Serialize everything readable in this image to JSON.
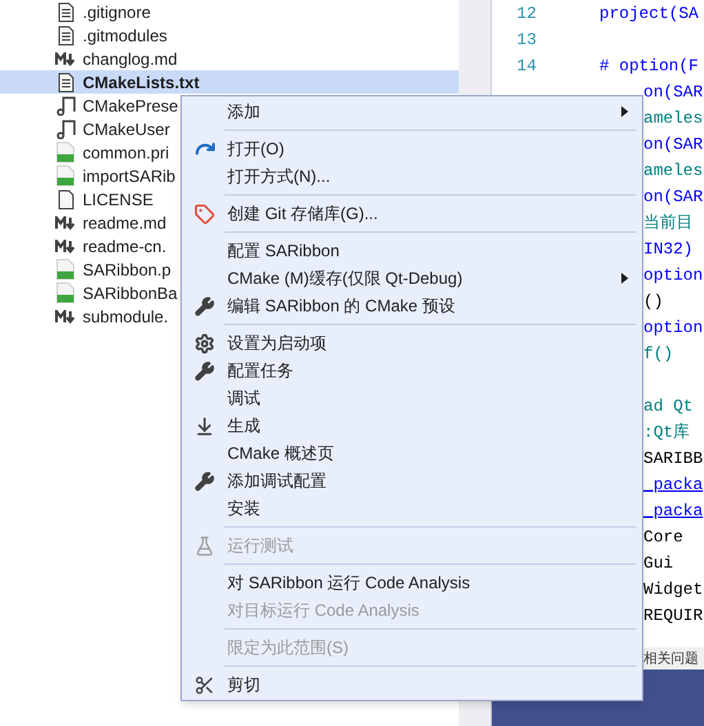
{
  "solution_explorer": {
    "items": [
      {
        "name": ".gitignore",
        "kind": "text",
        "selected": false
      },
      {
        "name": ".gitmodules",
        "kind": "text",
        "selected": false
      },
      {
        "name": "changlog.md",
        "kind": "markdown",
        "selected": false
      },
      {
        "name": "CMakeLists.txt",
        "kind": "text",
        "selected": true
      },
      {
        "name": "CMakePrese",
        "kind": "json",
        "selected": false
      },
      {
        "name": "CMakeUser",
        "kind": "json",
        "selected": false
      },
      {
        "name": "common.pri",
        "kind": "pro",
        "selected": false
      },
      {
        "name": "importSARib",
        "kind": "pro",
        "selected": false
      },
      {
        "name": "LICENSE",
        "kind": "blank",
        "selected": false
      },
      {
        "name": "readme.md",
        "kind": "markdown",
        "selected": false
      },
      {
        "name": "readme-cn.",
        "kind": "markdown",
        "selected": false
      },
      {
        "name": "SARibbon.p",
        "kind": "pro",
        "selected": false
      },
      {
        "name": "SARibbonBa",
        "kind": "pro",
        "selected": false
      },
      {
        "name": "submodule.",
        "kind": "markdown",
        "selected": false
      }
    ]
  },
  "editor": {
    "blocks": [
      {
        "lines": [
          {
            "number": "12",
            "segments": [
              {
                "text": "project(SA",
                "kind": "keyword"
              }
            ]
          },
          {
            "number": "13"
          },
          {
            "number": "14",
            "segments": [
              {
                "text": "# option(F",
                "kind": "keyword"
              }
            ]
          },
          {
            "segments": [
              {
                "text": "on(SAR",
                "kind": "keyword"
              }
            ]
          },
          {
            "segments": [
              {
                "text": "ameles",
                "kind": "comment"
              }
            ]
          },
          {
            "segments": [
              {
                "text": "on(SAR",
                "kind": "keyword"
              }
            ]
          },
          {
            "segments": [
              {
                "text": "ameles",
                "kind": "comment"
              }
            ]
          },
          {
            "segments": [
              {
                "text": "on(SAR",
                "kind": "keyword"
              }
            ]
          },
          {
            "segments": [
              {
                "text": "当前目",
                "kind": "comment"
              }
            ]
          },
          {
            "segments": [
              {
                "text": "IN32)",
                "kind": "keyword"
              }
            ]
          },
          {
            "segments": [
              {
                "text": "option",
                "kind": "keyword"
              }
            ]
          },
          {
            "segments": [
              {
                "text": "()",
                "kind": "plain"
              }
            ]
          },
          {
            "segments": [
              {
                "text": "option",
                "kind": "keyword"
              }
            ]
          },
          {
            "segments": [
              {
                "text": "f()",
                "kind": "comment"
              }
            ]
          }
        ]
      },
      {
        "lines": [
          {
            "segments": [
              {
                "text": "ad Qt",
                "kind": "comment"
              }
            ]
          },
          {
            "segments": [
              {
                "text": ":Qt库",
                "kind": "comment"
              }
            ]
          },
          {
            "segments": [
              {
                "text": "SARIBB",
                "kind": "plain"
              }
            ]
          },
          {
            "segments": [
              {
                "text": "_packa",
                "kind": "link"
              }
            ]
          },
          {
            "segments": [
              {
                "text": "_packa",
                "kind": "link"
              }
            ]
          },
          {
            "segments": [
              {
                "text": "Core",
                "kind": "plain"
              }
            ]
          },
          {
            "segments": [
              {
                "text": "Gui",
                "kind": "plain"
              }
            ]
          },
          {
            "segments": [
              {
                "text": "Widget",
                "kind": "plain"
              }
            ]
          },
          {
            "segments": [
              {
                "text": "REQUIR",
                "kind": "plain"
              }
            ]
          }
        ]
      }
    ],
    "hint": "相关问题"
  },
  "context_menu": {
    "items": [
      {
        "kind": "item",
        "label": "添加",
        "submenu": true,
        "disabled": false
      },
      {
        "kind": "separator"
      },
      {
        "kind": "item",
        "label": "打开(O)",
        "submenu": false,
        "disabled": false
      },
      {
        "kind": "item",
        "label": "打开方式(N)...",
        "submenu": false,
        "disabled": false
      },
      {
        "kind": "separator"
      },
      {
        "kind": "item",
        "label": "创建 Git 存储库(G)...",
        "submenu": false,
        "disabled": false
      },
      {
        "kind": "separator"
      },
      {
        "kind": "item",
        "label": "配置 SARibbon",
        "submenu": false,
        "disabled": false
      },
      {
        "kind": "item",
        "label": "CMake (M)缓存(仅限 Qt-Debug)",
        "submenu": true,
        "disabled": false
      },
      {
        "kind": "item",
        "label": "编辑 SARibbon 的 CMake 预设",
        "submenu": false,
        "disabled": false
      },
      {
        "kind": "separator"
      },
      {
        "kind": "item",
        "label": "设置为启动项",
        "submenu": false,
        "disabled": false
      },
      {
        "kind": "item",
        "label": "配置任务",
        "submenu": false,
        "disabled": false
      },
      {
        "kind": "item",
        "label": "调试",
        "submenu": false,
        "disabled": false
      },
      {
        "kind": "item",
        "label": "生成",
        "submenu": false,
        "disabled": false
      },
      {
        "kind": "item",
        "label": "CMake 概述页",
        "submenu": false,
        "disabled": false
      },
      {
        "kind": "item",
        "label": "添加调试配置",
        "submenu": false,
        "disabled": false
      },
      {
        "kind": "item",
        "label": "安装",
        "submenu": false,
        "disabled": false
      },
      {
        "kind": "separator"
      },
      {
        "kind": "item",
        "label": "运行测试",
        "submenu": false,
        "disabled": true
      },
      {
        "kind": "separator"
      },
      {
        "kind": "item",
        "label": "对 SARibbon 运行 Code Analysis",
        "submenu": false,
        "disabled": false
      },
      {
        "kind": "item",
        "label": "对目标运行 Code Analysis",
        "submenu": false,
        "disabled": true
      },
      {
        "kind": "separator"
      },
      {
        "kind": "item",
        "label": "限定为此范围(S)",
        "submenu": false,
        "disabled": true
      },
      {
        "kind": "separator"
      },
      {
        "kind": "item",
        "label": "剪切",
        "submenu": false,
        "disabled": false
      }
    ]
  }
}
